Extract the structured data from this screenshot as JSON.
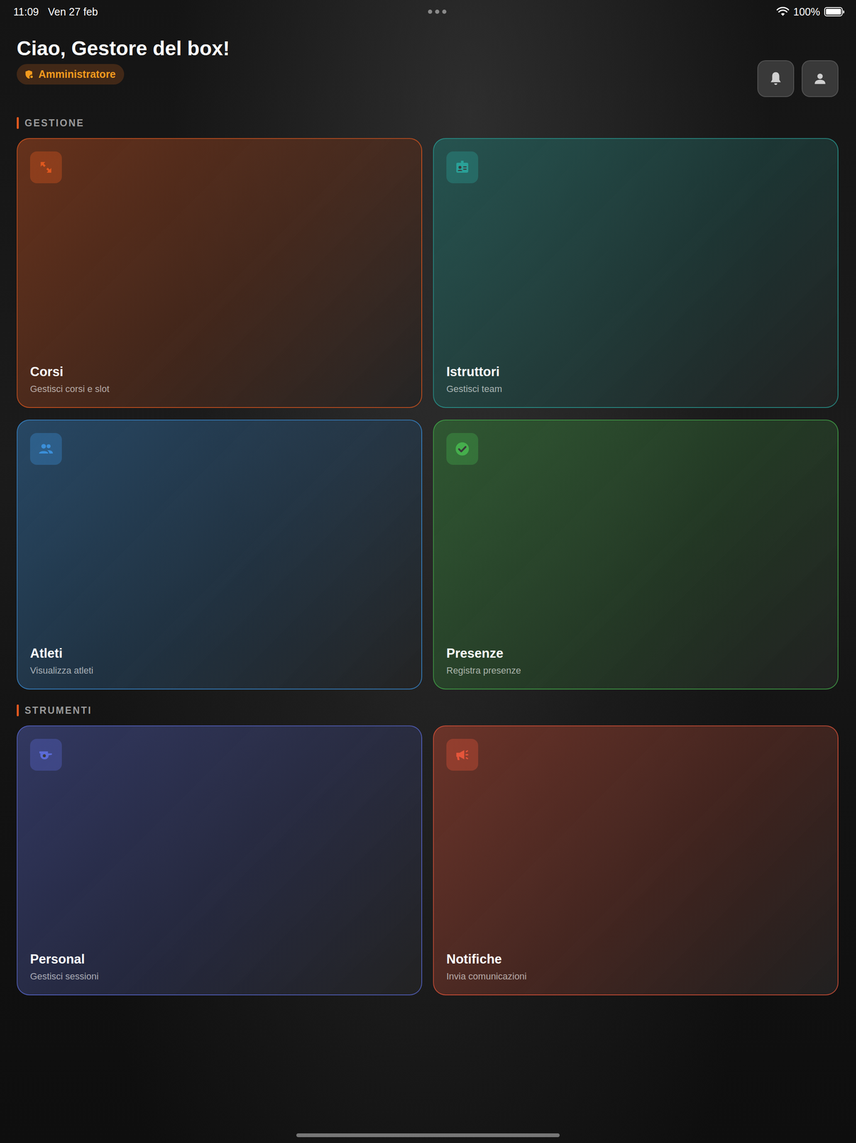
{
  "status_bar": {
    "time": "11:09",
    "date": "Ven 27 feb",
    "battery": "100%",
    "battery_level": 1.0
  },
  "header": {
    "greeting": "Ciao, Gestore del box!",
    "role_badge": "Amministratore"
  },
  "sections": [
    {
      "title": "GESTIONE",
      "cards": [
        {
          "title": "Corsi",
          "subtitle": "Gestisci corsi e slot",
          "color": "#e0581f"
        },
        {
          "title": "Istruttori",
          "subtitle": "Gestisci team",
          "color": "#2aa198"
        },
        {
          "title": "Atleti",
          "subtitle": "Visualizza atleti",
          "color": "#3b8fd9"
        },
        {
          "title": "Presenze",
          "subtitle": "Registra presenze",
          "color": "#45ae4c"
        }
      ]
    },
    {
      "title": "STRUMENTI",
      "cards": [
        {
          "title": "Personal",
          "subtitle": "Gestisci sessioni",
          "color": "#5b6bd6"
        },
        {
          "title": "Notifiche",
          "subtitle": "Invia comunicazioni",
          "color": "#e5553a"
        }
      ]
    }
  ]
}
